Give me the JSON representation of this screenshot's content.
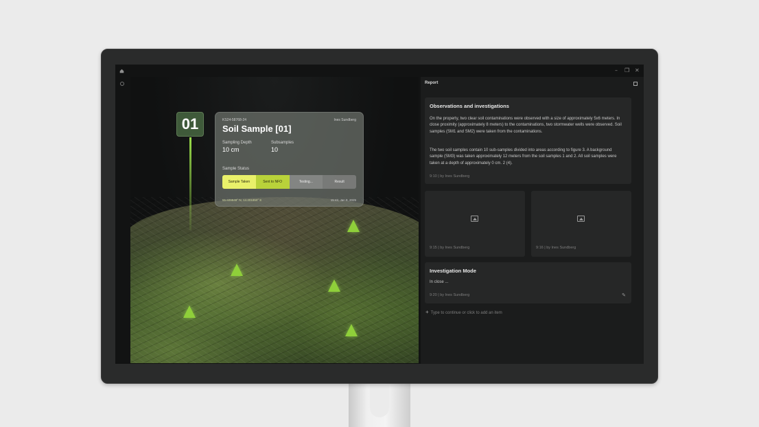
{
  "window": {
    "minimize_glyph": "–",
    "restore_glyph": "❐",
    "close_glyph": "✕"
  },
  "viewport": {
    "badge_number": "01",
    "card": {
      "id": "KS24-58768-24",
      "user": "Ines Sundberg",
      "title": "Soil Sample [01]",
      "depth_label": "Sampling Depth",
      "depth_value": "10 cm",
      "subsamples_label": "Subsamples",
      "subsamples_value": "10",
      "status_label": "Sample Status",
      "steps": [
        "Sample Taken",
        "Sent to NFO",
        "Testing...",
        "Result"
      ],
      "coords": "55.609948° N, 14.201850° E",
      "date": "15:42, Jan 8, 2025"
    }
  },
  "report": {
    "title": "Report",
    "observations": {
      "heading": "Observations and investigations",
      "paragraph_1": "On the property, two clear soil contaminations were observed with a size of approximately 5x6 meters. In close proximity (approximately 8 meters) to the contaminations, two stormwater wells were observed. Soil samples (SM1 and SM2) were taken from the contaminations.",
      "paragraph_2": "The two soil samples contain 10 sub-samples divided into areas according to figure 3. A background sample (SM3) was taken approximately 12 meters from the soil samples 1 and 2. All soil samples were taken at a depth of approximately  0 cm. 2 (4).",
      "meta": "9:10  |  by Ines Sundberg"
    },
    "images": [
      {
        "meta": "9:15  |  by Ines Sundberg",
        "icon": "image-icon"
      },
      {
        "meta": "9:16  |  by Ines Sundberg",
        "icon": "image-icon"
      }
    ],
    "investigation": {
      "heading": "Investigation Mode",
      "text": "In close ...",
      "meta": "9:20  |  by Ines Sundberg"
    },
    "add_placeholder": "Type to continue or click to add an item"
  },
  "colors": {
    "accent_green": "#9be04a",
    "status_active": "#e9f06a"
  }
}
